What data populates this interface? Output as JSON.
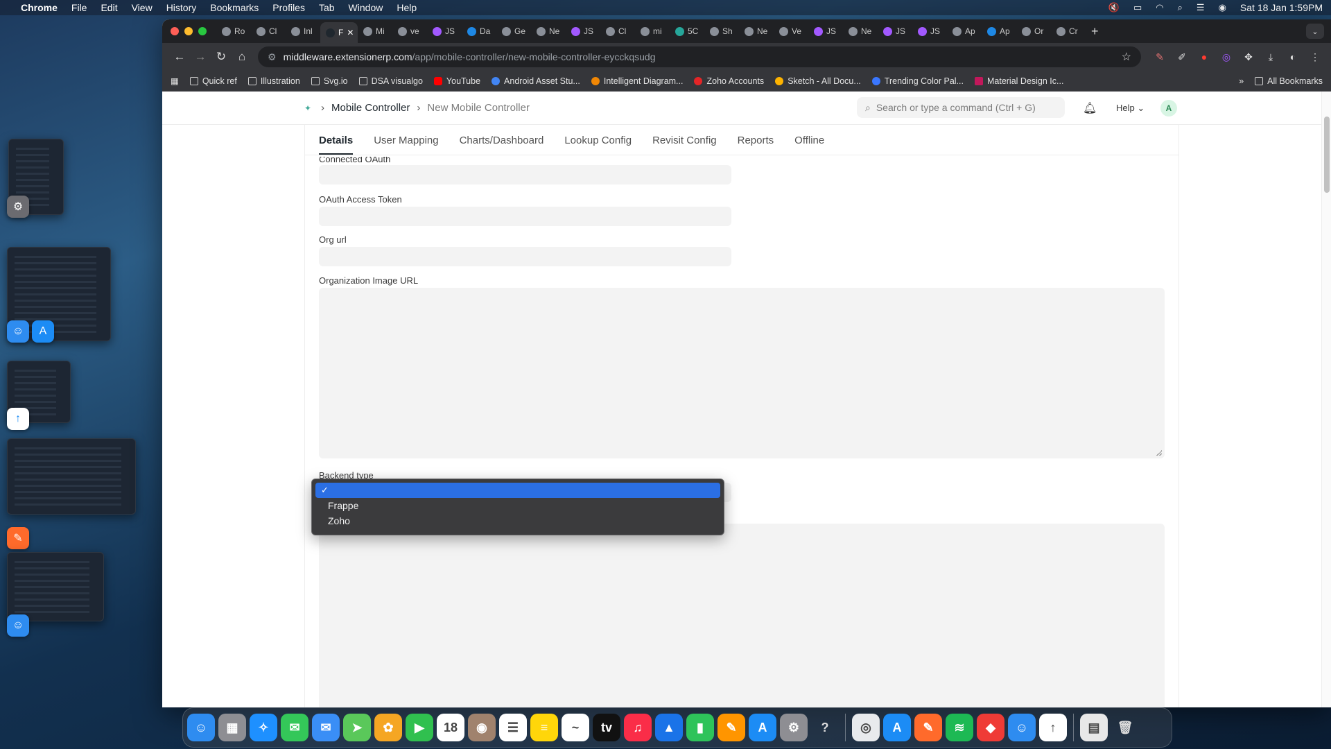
{
  "menubar": {
    "app": "Chrome",
    "items": [
      "File",
      "Edit",
      "View",
      "History",
      "Bookmarks",
      "Profiles",
      "Tab",
      "Window",
      "Help"
    ],
    "datetime": "Sat 18 Jan  1:59PM"
  },
  "tabs": [
    {
      "label": "Ro"
    },
    {
      "label": "Cl"
    },
    {
      "label": "Inl"
    },
    {
      "label": "F",
      "active": true
    },
    {
      "label": "Mi"
    },
    {
      "label": "ve"
    },
    {
      "label": "JS"
    },
    {
      "label": "Da"
    },
    {
      "label": "Ge"
    },
    {
      "label": "Ne"
    },
    {
      "label": "JS"
    },
    {
      "label": "Cl"
    },
    {
      "label": "mi"
    },
    {
      "label": "5C"
    },
    {
      "label": "Sh"
    },
    {
      "label": "Ne"
    },
    {
      "label": "Ve"
    },
    {
      "label": "JS"
    },
    {
      "label": "Ne"
    },
    {
      "label": "JS"
    },
    {
      "label": "JS"
    },
    {
      "label": "Ap"
    },
    {
      "label": "Ap"
    },
    {
      "label": "Or"
    },
    {
      "label": "Cr"
    }
  ],
  "address": {
    "host": "middleware.extensionerp.com",
    "path": "/app/mobile-controller/new-mobile-controller-eycckqsudg"
  },
  "bookmarks": [
    {
      "label": "Quick ref",
      "kind": "folder"
    },
    {
      "label": "Illustration",
      "kind": "folder"
    },
    {
      "label": "Svg.io",
      "kind": "folder"
    },
    {
      "label": "DSA visualgo",
      "kind": "folder"
    },
    {
      "label": "YouTube",
      "kind": "site",
      "color": "#ff0000"
    },
    {
      "label": "Android Asset Stu...",
      "kind": "site",
      "color": "#4285f4"
    },
    {
      "label": "Intelligent Diagram...",
      "kind": "site",
      "color": "#f08705"
    },
    {
      "label": "Zoho Accounts",
      "kind": "site",
      "color": "#e42527"
    },
    {
      "label": "Sketch - All Docu...",
      "kind": "site",
      "color": "#fdb300"
    },
    {
      "label": "Trending Color Pal...",
      "kind": "site",
      "color": "#3a77ff"
    },
    {
      "label": "Material Design Ic...",
      "kind": "site",
      "color": "#c2185b"
    }
  ],
  "bookmarks_right": "All Bookmarks",
  "breadcrumb": {
    "parent": "Mobile Controller",
    "current": "New Mobile Controller"
  },
  "search": {
    "placeholder": "Search or type a command (Ctrl + G)"
  },
  "help_label": "Help",
  "avatar_initial": "A",
  "form_tabs": [
    {
      "label": "Details",
      "active": true
    },
    {
      "label": "User Mapping"
    },
    {
      "label": "Charts/Dashboard"
    },
    {
      "label": "Lookup Config"
    },
    {
      "label": "Revisit Config"
    },
    {
      "label": "Reports"
    },
    {
      "label": "Offline"
    }
  ],
  "fields": {
    "connected_oauth": "Connected OAuth",
    "oauth_access_token": "OAuth Access Token",
    "org_url": "Org url",
    "organization_image_url": "Organization Image URL",
    "backend_type": "Backend type"
  },
  "backend_options": [
    {
      "label": "",
      "selected": true
    },
    {
      "label": "Frappe"
    },
    {
      "label": "Zoho"
    }
  ],
  "dock": [
    {
      "name": "finder-icon",
      "color": "#2e8cf0",
      "glyph": "☺"
    },
    {
      "name": "launchpad-icon",
      "color": "#8e8e93",
      "glyph": "▦"
    },
    {
      "name": "safari-icon",
      "color": "#1e90ff",
      "glyph": "✧"
    },
    {
      "name": "messages-icon",
      "color": "#34c759",
      "glyph": "✉"
    },
    {
      "name": "mail-icon",
      "color": "#3a8ef6",
      "glyph": "✉"
    },
    {
      "name": "maps-icon",
      "color": "#5ac85a",
      "glyph": "➤"
    },
    {
      "name": "photos-icon",
      "color": "#f5a623",
      "glyph": "✿"
    },
    {
      "name": "facetime-icon",
      "color": "#30c04f",
      "glyph": "▶"
    },
    {
      "name": "calendar-icon",
      "color": "#ffffff",
      "glyph": "18"
    },
    {
      "name": "contacts-icon",
      "color": "#a0826d",
      "glyph": "◉"
    },
    {
      "name": "reminders-icon",
      "color": "#ffffff",
      "glyph": "☰"
    },
    {
      "name": "notes-icon",
      "color": "#ffd60a",
      "glyph": "≡"
    },
    {
      "name": "freeform-icon",
      "color": "#ffffff",
      "glyph": "~"
    },
    {
      "name": "tv-icon",
      "color": "#111111",
      "glyph": "tv"
    },
    {
      "name": "music-icon",
      "color": "#fa2d48",
      "glyph": "♫"
    },
    {
      "name": "keynote-icon",
      "color": "#1a73e8",
      "glyph": "▲"
    },
    {
      "name": "numbers-icon",
      "color": "#2ec35a",
      "glyph": "▮"
    },
    {
      "name": "pages-icon",
      "color": "#ff9500",
      "glyph": "✎"
    },
    {
      "name": "app-store-icon",
      "color": "#1c8cf5",
      "glyph": "A"
    },
    {
      "name": "system-settings-icon",
      "color": "#8e8e93",
      "glyph": "⚙"
    },
    {
      "name": "help-icon",
      "color": "transparent",
      "glyph": "?"
    },
    {
      "name": "separator"
    },
    {
      "name": "chrome-icon",
      "color": "#e8eaed",
      "glyph": "◎"
    },
    {
      "name": "xcode-instruments-icon",
      "color": "#1c8cf5",
      "glyph": "A"
    },
    {
      "name": "sketch-pen-icon",
      "color": "#ff6a2b",
      "glyph": "✎"
    },
    {
      "name": "spotify-icon",
      "color": "#1db954",
      "glyph": "≋"
    },
    {
      "name": "anydesk-icon",
      "color": "#ef3b36",
      "glyph": "◆"
    },
    {
      "name": "finder-alt-icon",
      "color": "#2e8cf0",
      "glyph": "☺"
    },
    {
      "name": "transfer-icon",
      "color": "#ffffff",
      "glyph": "↑"
    },
    {
      "name": "separator"
    },
    {
      "name": "document-icon",
      "color": "#e8e8e8",
      "glyph": "▤"
    },
    {
      "name": "trash-icon",
      "color": "transparent",
      "glyph": "🗑"
    }
  ]
}
